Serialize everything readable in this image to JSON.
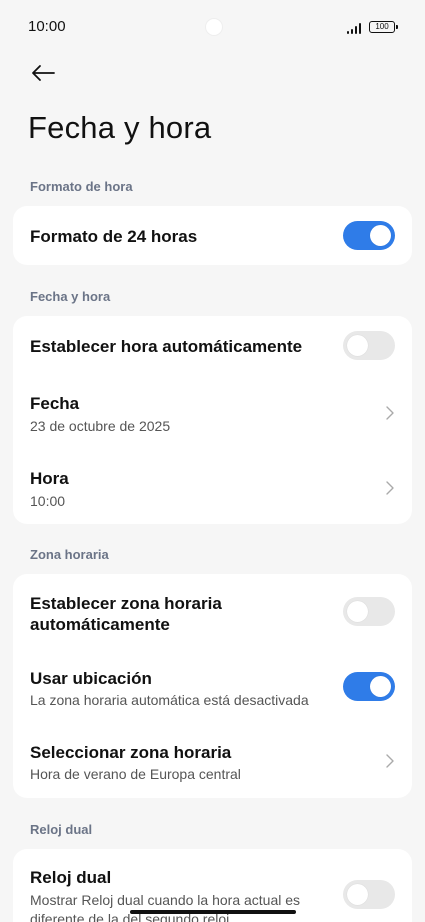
{
  "status_bar": {
    "time": "10:00",
    "battery": "100"
  },
  "header": {
    "title": "Fecha y hora"
  },
  "sections": {
    "time_format": {
      "label": "Formato de hora",
      "rows": [
        {
          "title": "Formato de 24 horas",
          "toggle": true
        }
      ]
    },
    "date_time": {
      "label": "Fecha y hora",
      "rows": [
        {
          "title": "Establecer hora automáticamente",
          "toggle": false
        },
        {
          "title": "Fecha",
          "subtitle": "23 de octubre de 2025"
        },
        {
          "title": "Hora",
          "subtitle": "10:00"
        }
      ]
    },
    "time_zone": {
      "label": "Zona horaria",
      "rows": [
        {
          "title": "Establecer zona horaria automáticamente",
          "toggle": false
        },
        {
          "title": "Usar ubicación",
          "subtitle": "La zona horaria automática está desactivada",
          "toggle": true
        },
        {
          "title": "Seleccionar zona horaria",
          "subtitle": "Hora de verano de Europa central"
        }
      ]
    },
    "dual_clock": {
      "label": "Reloj dual",
      "rows": [
        {
          "title": "Reloj dual",
          "subtitle": "Mostrar Reloj dual cuando la hora actual es diferente de la del segundo reloj",
          "toggle": false
        }
      ]
    }
  },
  "colors": {
    "accent": "#2f7ce8",
    "section_label": "#6b7487",
    "background": "#f6f6f6"
  },
  "icons": {
    "back": "arrow-left-icon",
    "chevron": "chevron-right-icon"
  }
}
